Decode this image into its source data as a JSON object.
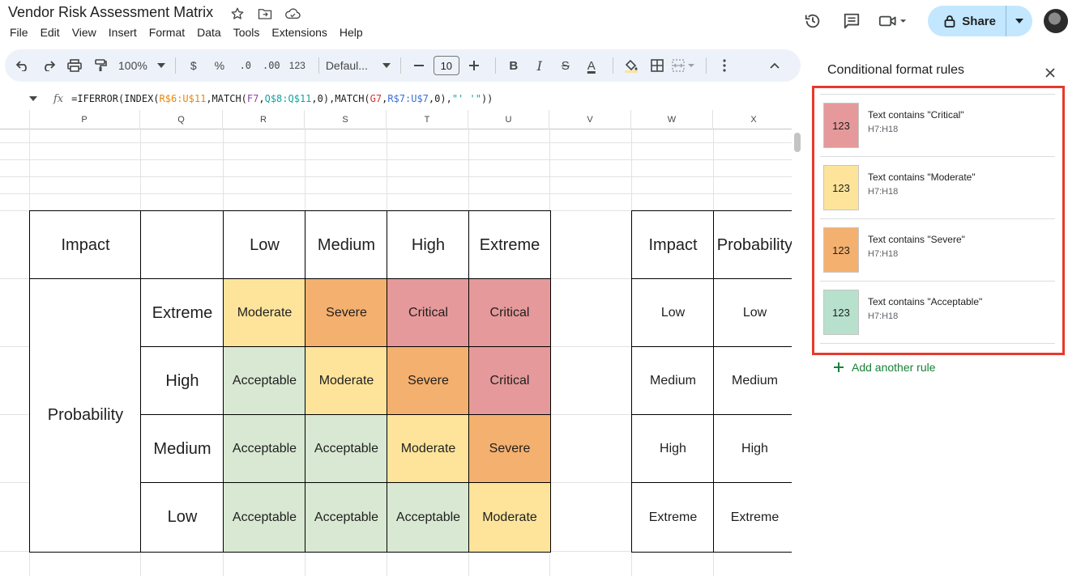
{
  "title": "Vendor Risk Assessment Matrix",
  "menu": [
    "File",
    "Edit",
    "View",
    "Insert",
    "Format",
    "Data",
    "Tools",
    "Extensions",
    "Help"
  ],
  "share_label": "Share",
  "toolbar": {
    "zoom": "100%",
    "currency": "$",
    "percent": "%",
    "dec_decrease": ".0",
    "dec_increase": ".00",
    "number_format": "123",
    "font": "Defaul...",
    "font_size": "10",
    "bold": "B",
    "italic": "I",
    "strike": "S",
    "text_color": "A"
  },
  "formula": {
    "fx": "fx",
    "parts": [
      {
        "t": "=IFERROR(INDEX(",
        "c": ""
      },
      {
        "t": "R$6:U$11",
        "c": "c-orange"
      },
      {
        "t": ",MATCH(",
        "c": ""
      },
      {
        "t": "F7",
        "c": "c-purple"
      },
      {
        "t": ",",
        "c": ""
      },
      {
        "t": "Q$8:Q$11",
        "c": "c-teal"
      },
      {
        "t": ",0),MATCH(",
        "c": ""
      },
      {
        "t": "G7",
        "c": "c-red"
      },
      {
        "t": ",",
        "c": ""
      },
      {
        "t": "R$7:U$7",
        "c": "c-blue"
      },
      {
        "t": ",0),",
        "c": ""
      },
      {
        "t": "\"' '\"",
        "c": "c-teal"
      },
      {
        "t": "))",
        "c": ""
      }
    ]
  },
  "columns": [
    "P",
    "Q",
    "R",
    "S",
    "T",
    "U",
    "V",
    "W",
    "X"
  ],
  "matrix": {
    "impact_label": "Impact",
    "probability_label": "Probability",
    "impact_levels": [
      "Low",
      "Medium",
      "High",
      "Extreme"
    ],
    "probability_levels": [
      "Extreme",
      "High",
      "Medium",
      "Low"
    ],
    "cells": [
      [
        "Moderate",
        "Severe",
        "Critical",
        "Critical"
      ],
      [
        "Acceptable",
        "Moderate",
        "Severe",
        "Critical"
      ],
      [
        "Acceptable",
        "Acceptable",
        "Moderate",
        "Severe"
      ],
      [
        "Acceptable",
        "Acceptable",
        "Acceptable",
        "Moderate"
      ]
    ]
  },
  "lookup_table": {
    "headers": [
      "Impact",
      "Probability"
    ],
    "rows": [
      [
        "Low",
        "Low"
      ],
      [
        "Medium",
        "Medium"
      ],
      [
        "High",
        "High"
      ],
      [
        "Extreme",
        "Extreme"
      ]
    ]
  },
  "colors": {
    "Critical": "#e6999a",
    "Severe": "#f4b06e",
    "Moderate": "#fde49a",
    "Acceptable": "#d9e8d2"
  },
  "panel": {
    "title": "Conditional format rules",
    "rules": [
      {
        "swatch": "123",
        "text": "Text contains \"Critical\"",
        "range": "H7:H18",
        "color": "#e6999a"
      },
      {
        "swatch": "123",
        "text": "Text contains \"Moderate\"",
        "range": "H7:H18",
        "color": "#fde49a"
      },
      {
        "swatch": "123",
        "text": "Text contains \"Severe\"",
        "range": "H7:H18",
        "color": "#f4b06e"
      },
      {
        "swatch": "123",
        "text": "Text contains \"Acceptable\"",
        "range": "H7:H18",
        "color": "#b7e1cd"
      }
    ],
    "add_rule": "Add another rule"
  }
}
